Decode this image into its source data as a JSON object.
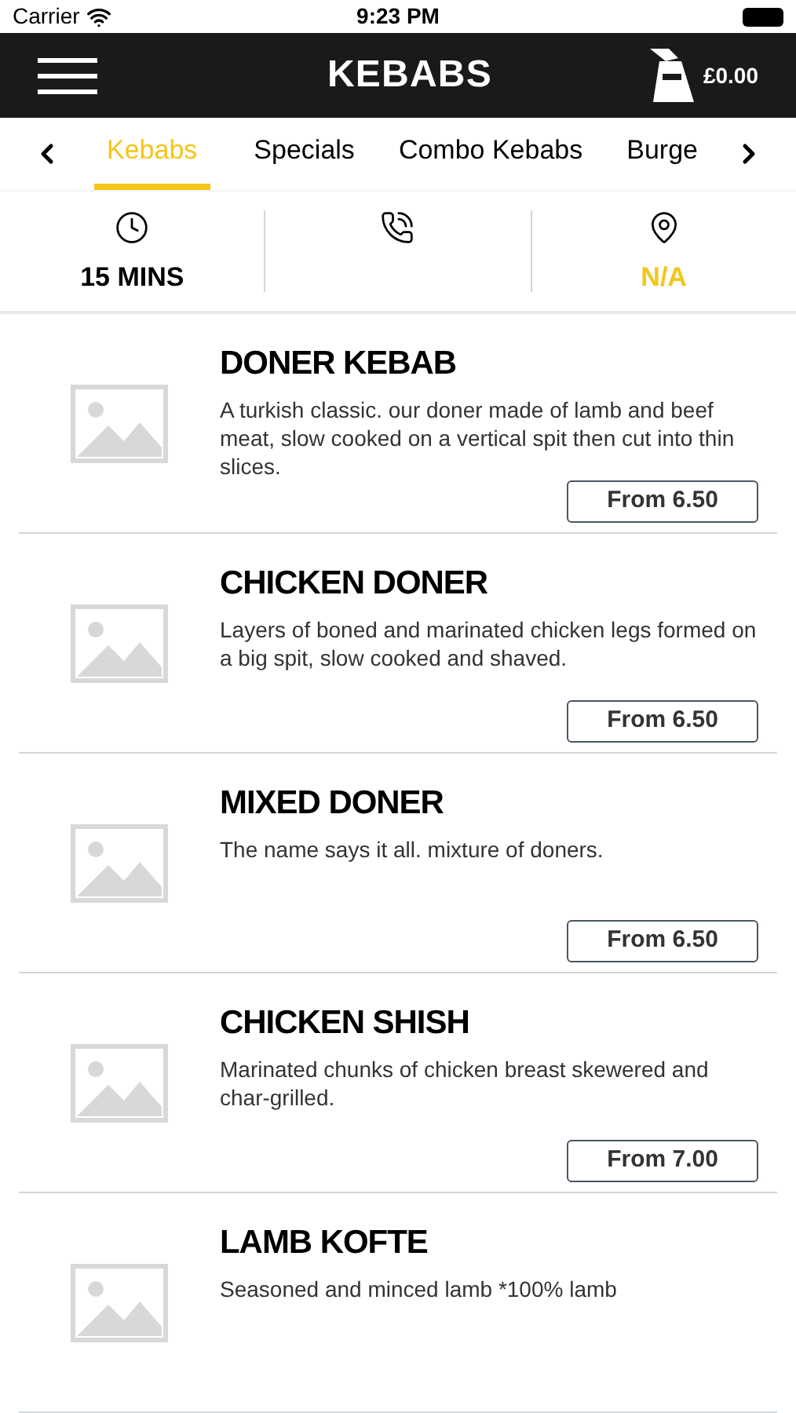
{
  "status_bar": {
    "carrier": "Carrier",
    "time": "9:23 PM"
  },
  "header": {
    "title": "KEBABS",
    "cart_total": "£0.00"
  },
  "tabs": [
    {
      "label": "Kebabs",
      "selected": true
    },
    {
      "label": "Specials",
      "selected": false
    },
    {
      "label": "Combo Kebabs",
      "selected": false
    },
    {
      "label": "Burge",
      "selected": false
    }
  ],
  "info": [
    {
      "kind": "time",
      "text": "15 MINS"
    },
    {
      "kind": "phone"
    },
    {
      "kind": "location",
      "text": "N/A"
    }
  ],
  "items": [
    {
      "name": "DONER KEBAB",
      "description": "A turkish classic. our doner made of lamb and beef meat, slow cooked on a vertical spit then cut into thin slices.",
      "price": "From 6.50"
    },
    {
      "name": "CHICKEN DONER",
      "description": "Layers of boned and marinated chicken legs formed on a big spit, slow cooked and shaved.",
      "price": "From 6.50"
    },
    {
      "name": "MIXED DONER",
      "description": "The name says it all. mixture of doners.",
      "price": "From 6.50"
    },
    {
      "name": "CHICKEN SHISH",
      "description": "Marinated chunks of chicken breast skewered and char-grilled.",
      "price": "From 7.00"
    },
    {
      "name": "LAMB KOFTE",
      "description": "Seasoned and minced lamb *100% lamb"
    }
  ]
}
